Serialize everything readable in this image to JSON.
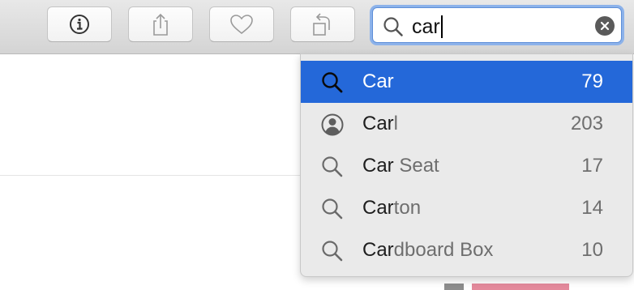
{
  "toolbar": {
    "buttons": [
      {
        "name": "info-button",
        "icon": "info-circle-icon"
      },
      {
        "name": "share-button",
        "icon": "share-icon"
      },
      {
        "name": "favorite-button",
        "icon": "heart-icon"
      },
      {
        "name": "rotate-button",
        "icon": "rotate-left-icon"
      }
    ]
  },
  "search": {
    "value": "car",
    "icon": "search-icon",
    "clear_icon": "clear-x-icon"
  },
  "suggestions": [
    {
      "match": "Car",
      "rest": "",
      "count": "79",
      "icon": "search-icon",
      "selected": true
    },
    {
      "match": "Car",
      "rest": "l",
      "count": "203",
      "icon": "person-icon",
      "selected": false
    },
    {
      "match": "Car",
      "rest": " Seat",
      "count": "17",
      "icon": "search-icon",
      "selected": false
    },
    {
      "match": "Car",
      "rest": "ton",
      "count": "14",
      "icon": "search-icon",
      "selected": false
    },
    {
      "match": "Car",
      "rest": "dboard Box",
      "count": "10",
      "icon": "search-icon",
      "selected": false
    }
  ],
  "colors": {
    "selection": "#2468d9",
    "focus_ring": "#8cb2ea"
  }
}
